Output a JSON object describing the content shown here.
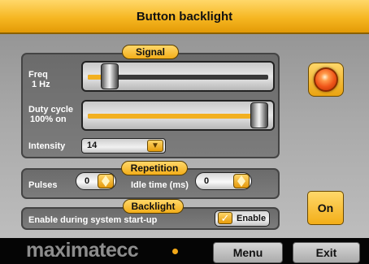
{
  "title": "Button backlight",
  "signal": {
    "tag": "Signal",
    "freq_label_line1": "Freq",
    "freq_label_line2": "1 Hz",
    "freq_slider_value": 0.08,
    "duty_label_line1": "Duty cycle",
    "duty_label_line2": "100% on",
    "duty_slider_value": 1.0,
    "intensity_label": "Intensity",
    "intensity_value": "14",
    "dropdown_icon": "chevron-down-icon"
  },
  "repetition": {
    "tag": "Repetition",
    "pulses_label": "Pulses",
    "pulses_value": "0",
    "idle_label": "Idle time (ms)",
    "idle_value": "0"
  },
  "backlight": {
    "tag": "Backlight",
    "enable_label": "Enable during system start-up",
    "enable_checked": true,
    "enable_button": "Enable"
  },
  "side": {
    "led_icon": "led-indicator-icon",
    "led_color": "#f0561a",
    "on_button": "On"
  },
  "footer": {
    "logo": "maximatecc",
    "logo_dot_color": "#f2a818",
    "menu_button": "Menu",
    "exit_button": "Exit"
  },
  "colors": {
    "accent": "#f3ae18",
    "panel": "#6b6b6b",
    "background": "#a9a9a9"
  }
}
